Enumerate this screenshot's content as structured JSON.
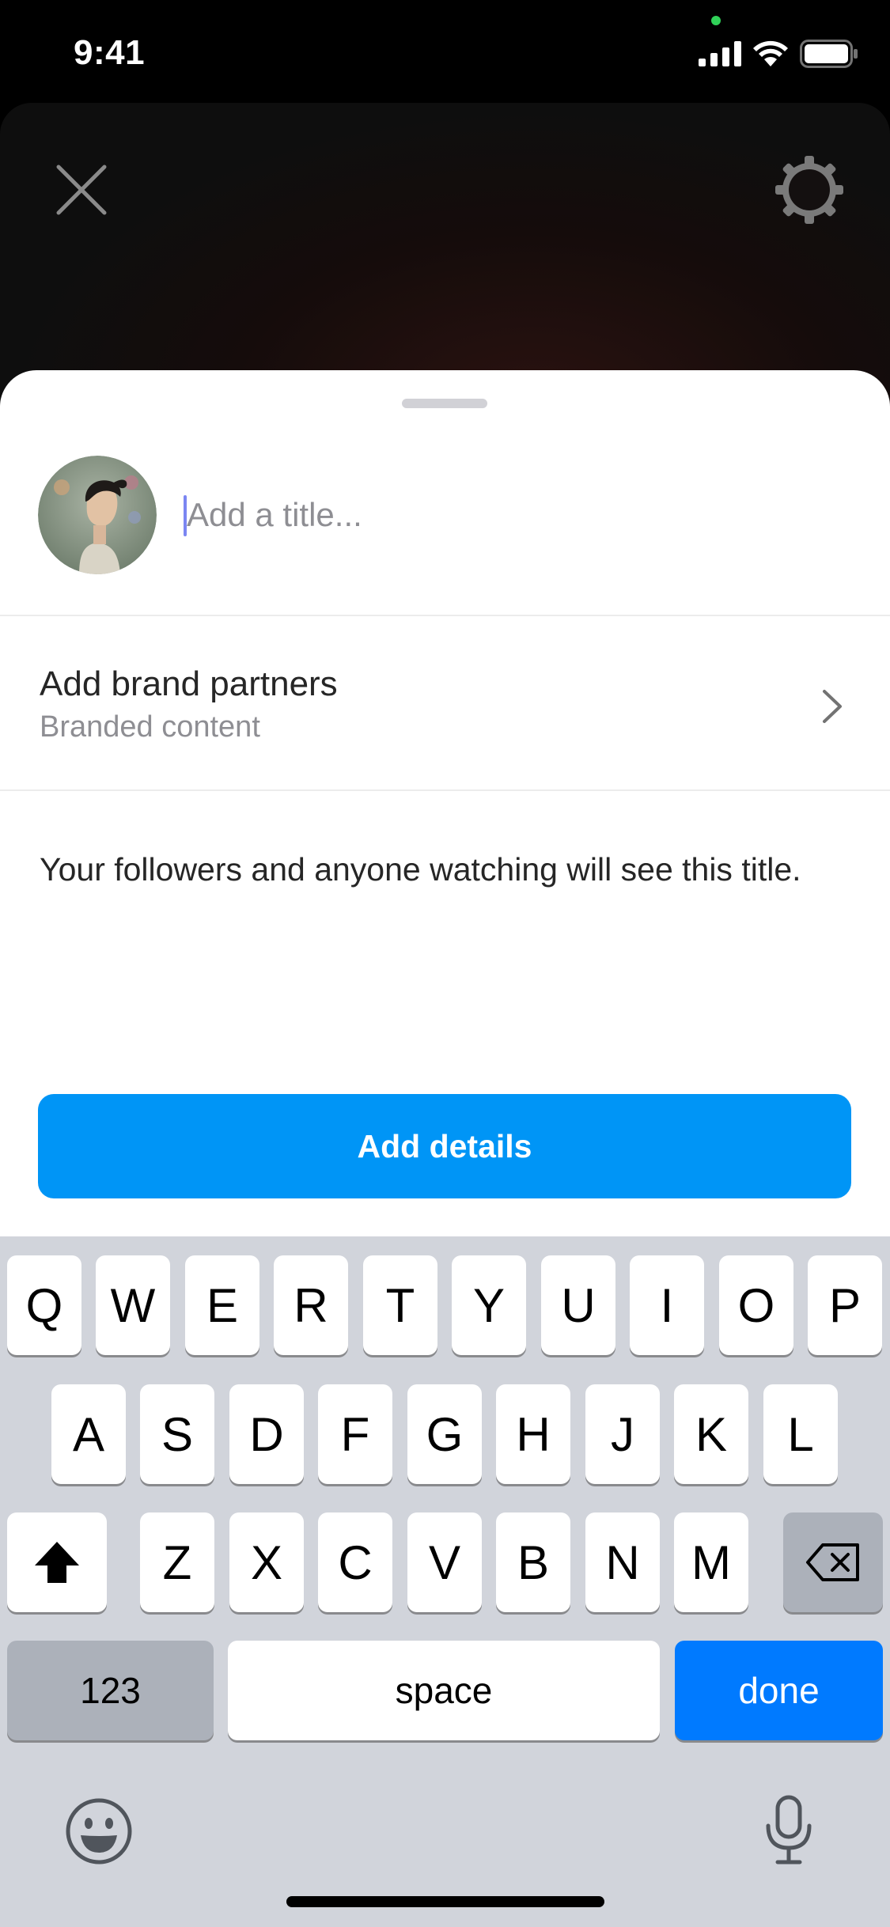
{
  "status_bar": {
    "time": "9:41"
  },
  "sheet": {
    "title_input": {
      "value": "",
      "placeholder": "Add a title..."
    },
    "brand_partners": {
      "title": "Add brand partners",
      "subtitle": "Branded content"
    },
    "info_text": "Your followers and anyone watching will see this title.",
    "primary_button": "Add details",
    "accent_color": "#0095f6"
  },
  "keyboard": {
    "row1": [
      "Q",
      "W",
      "E",
      "R",
      "T",
      "Y",
      "U",
      "I",
      "O",
      "P"
    ],
    "row2": [
      "A",
      "S",
      "D",
      "F",
      "G",
      "H",
      "J",
      "K",
      "L"
    ],
    "row3": [
      "Z",
      "X",
      "C",
      "V",
      "B",
      "N",
      "M"
    ],
    "numbers_label": "123",
    "space_label": "space",
    "done_label": "done",
    "icons": [
      "shift-icon",
      "backspace-icon",
      "emoji-icon",
      "microphone-icon"
    ]
  }
}
